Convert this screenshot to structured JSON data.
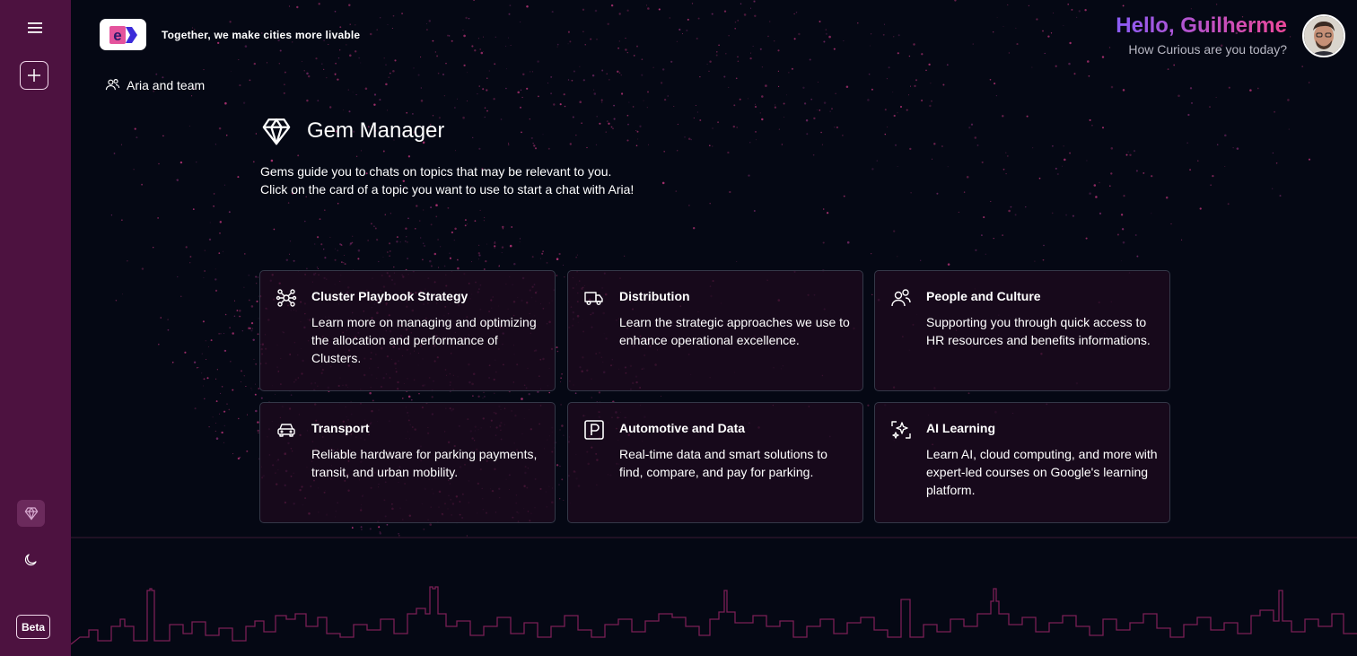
{
  "brand": {
    "logo_letter": "e",
    "tagline": "Together, we make cities more livable"
  },
  "header": {
    "greeting": "Hello, Guilherme",
    "subtitle": "How Curious are you today?"
  },
  "team": {
    "label": "Aria and team"
  },
  "page": {
    "title": "Gem Manager",
    "description_line1": "Gems guide you to chats on topics that may be relevant to you.",
    "description_line2": "Click on the card of a topic you want to use to start a chat with Aria!"
  },
  "cards": [
    {
      "icon": "network-icon",
      "title": "Cluster Playbook Strategy",
      "text": "Learn more on managing and optimizing the allocation and performance of Clusters."
    },
    {
      "icon": "truck-icon",
      "title": "Distribution",
      "text": "Learn the strategic approaches we use to enhance operational excellence."
    },
    {
      "icon": "people-icon",
      "title": "People and Culture",
      "text": "Supporting you through quick access to HR resources and benefits informations."
    },
    {
      "icon": "car-icon",
      "title": "Transport",
      "text": "Reliable hardware for parking payments, transit, and urban mobility."
    },
    {
      "icon": "parking-icon",
      "title": "Automotive and Data",
      "text": "Real-time data and smart solutions to find, compare, and pay for parking."
    },
    {
      "icon": "sparkle-icon",
      "title": "AI Learning",
      "text": "Learn AI, cloud computing, and more with expert-led courses on Google's learning platform."
    }
  ],
  "sidebar": {
    "beta_label": "Beta"
  },
  "colors": {
    "background": "#050814",
    "sidebar": "#4d1240",
    "accent_pink": "#ec4899",
    "accent_purple": "#8b5cf6",
    "card_border": "#343848"
  }
}
